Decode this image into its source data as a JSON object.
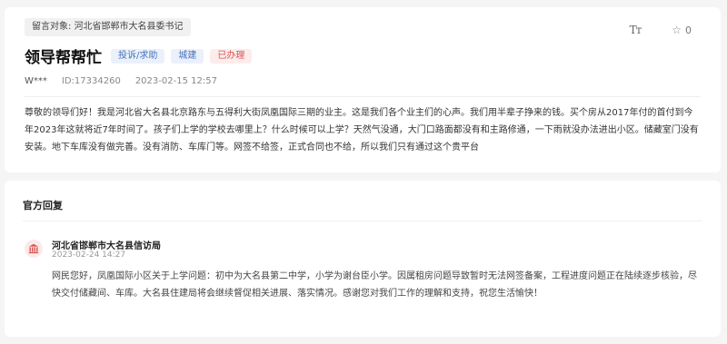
{
  "message": {
    "target_label": "留言对象:",
    "target_value": "河北省邯郸市大名县委书记",
    "title": "领导帮帮忙",
    "tags": [
      "投诉/求助",
      "城建",
      "已办理"
    ],
    "font_button_label": "Tт",
    "favorite_count": "0",
    "user": "W***",
    "id_text": "ID:17334260",
    "datetime": "2023-02-15 12:57",
    "content": "尊敬的领导们好！我是河北省大名县北京路东与五得利大街凤凰国际三期的业主。这是我们各个业主们的心声。我们用半辈子挣来的钱。买个房从2017年付的首付到今年2023年这就将近7年时间了。孩子们上学的学校去哪里上？什么时候可以上学？天然气没通，大门口路面都没有和主路修通，一下雨就没办法进出小区。储藏室门没有安装。地下车库没有做完善。没有消防、车库门等。网签不给签，正式合同也不给，所以我们只有通过这个贵平台"
  },
  "reply": {
    "section_title": "官方回复",
    "office": "河北省邯郸市大名县信访局",
    "datetime": "2023-02-24 14:27",
    "content": "网民您好，凤凰国际小区关于上学问题：初中为大名县第二中学，小学为谢台臣小学。因属租房问题导致暂时无法网签备案，工程进度问题正在陆续逐步核验，尽快交付储藏间、车库。大名县住建局将会继续督促相关进展、落实情况。感谢您对我们工作的理解和支持，祝您生活愉快！"
  },
  "icons": {
    "font_size": "font-size-icon",
    "favorite": "star-icon",
    "office_avatar": "government-building-icon"
  },
  "colors": {
    "tag_blue_bg": "#eaf1fb",
    "tag_blue_text": "#4a72b8",
    "tag_red_bg": "#fdecec",
    "tag_red_text": "#d9534f",
    "avatar_bg": "#fbeaea",
    "avatar_icon": "#d9534f"
  }
}
